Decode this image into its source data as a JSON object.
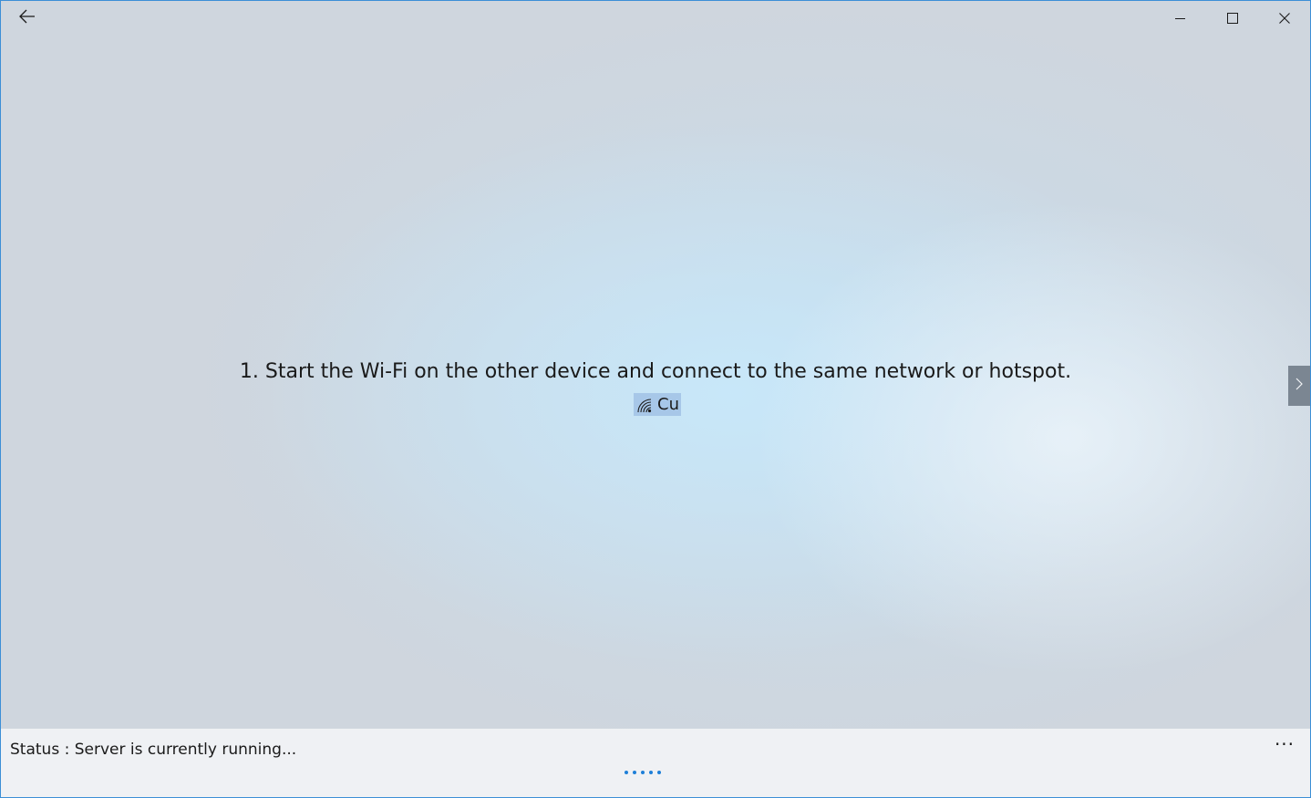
{
  "titlebar": {
    "back_icon": "back-arrow-icon",
    "minimize_icon": "minimize-icon",
    "maximize_icon": "maximize-icon",
    "close_icon": "close-icon"
  },
  "main": {
    "instruction": "1. Start the Wi-Fi on the other device and connect to the same network or hotspot.",
    "network": {
      "icon": "wifi-icon",
      "name": "Cu"
    },
    "next_icon": "chevron-right-icon"
  },
  "statusbar": {
    "status_text": "Status : Server is currently running...",
    "more_label": "...",
    "progress_dot_count": 5
  },
  "colors": {
    "accent": "#1e7fd8",
    "window_border": "#3c8fd6",
    "chip_highlight": "#a7c7e8",
    "statusbar_bg": "#eff1f4"
  }
}
